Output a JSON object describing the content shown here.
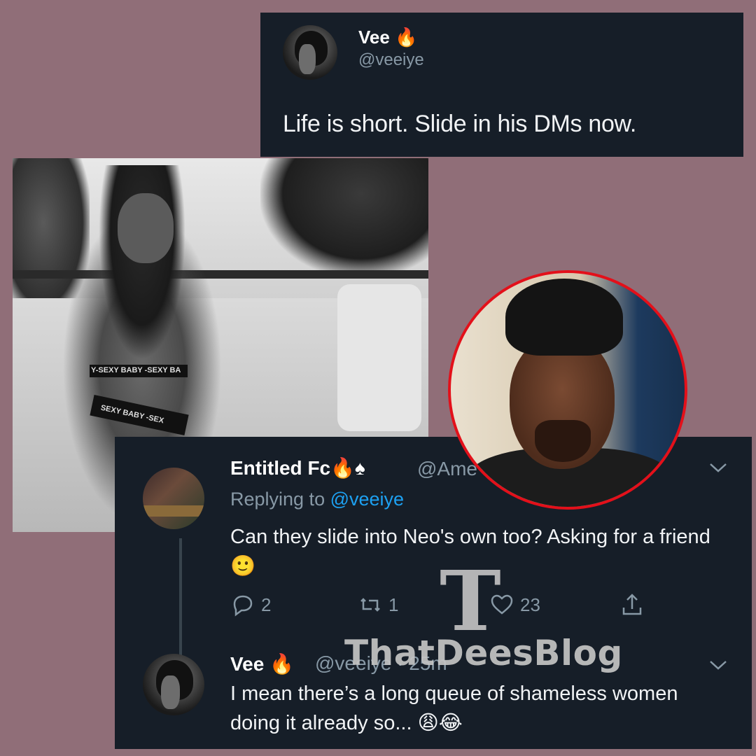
{
  "top_tweet": {
    "name": "Vee 🔥",
    "handle": "@veeiye",
    "text": "Life is short. Slide in his DMs now."
  },
  "photo": {
    "band_text_top": "Y-SEXY BABY -SEXY BA",
    "band_text_bottom": "SEXY BABY -SEX"
  },
  "reply_thread": {
    "reply1": {
      "name": "Entitled Fc🔥♠",
      "handle": "@Ame",
      "replying_label": "Replying to",
      "replying_mention": "@veeiye",
      "text": "Can they slide into Neo's own too? Asking for a friend🙂",
      "actions": {
        "replies": "2",
        "retweets": "1",
        "likes": "23"
      }
    },
    "reply2": {
      "name": "Vee 🔥",
      "handle": "@veeiye · 25m",
      "text": "I mean there’s a long queue of shameless women doing it already so... 😩😂"
    }
  },
  "watermark": {
    "letter": "T",
    "text": "ThatDeesBlog"
  },
  "colors": {
    "background": "#906e78",
    "card": "#161e28",
    "link": "#1da1f2",
    "muted": "#8899a6",
    "ring": "#e3101a"
  }
}
